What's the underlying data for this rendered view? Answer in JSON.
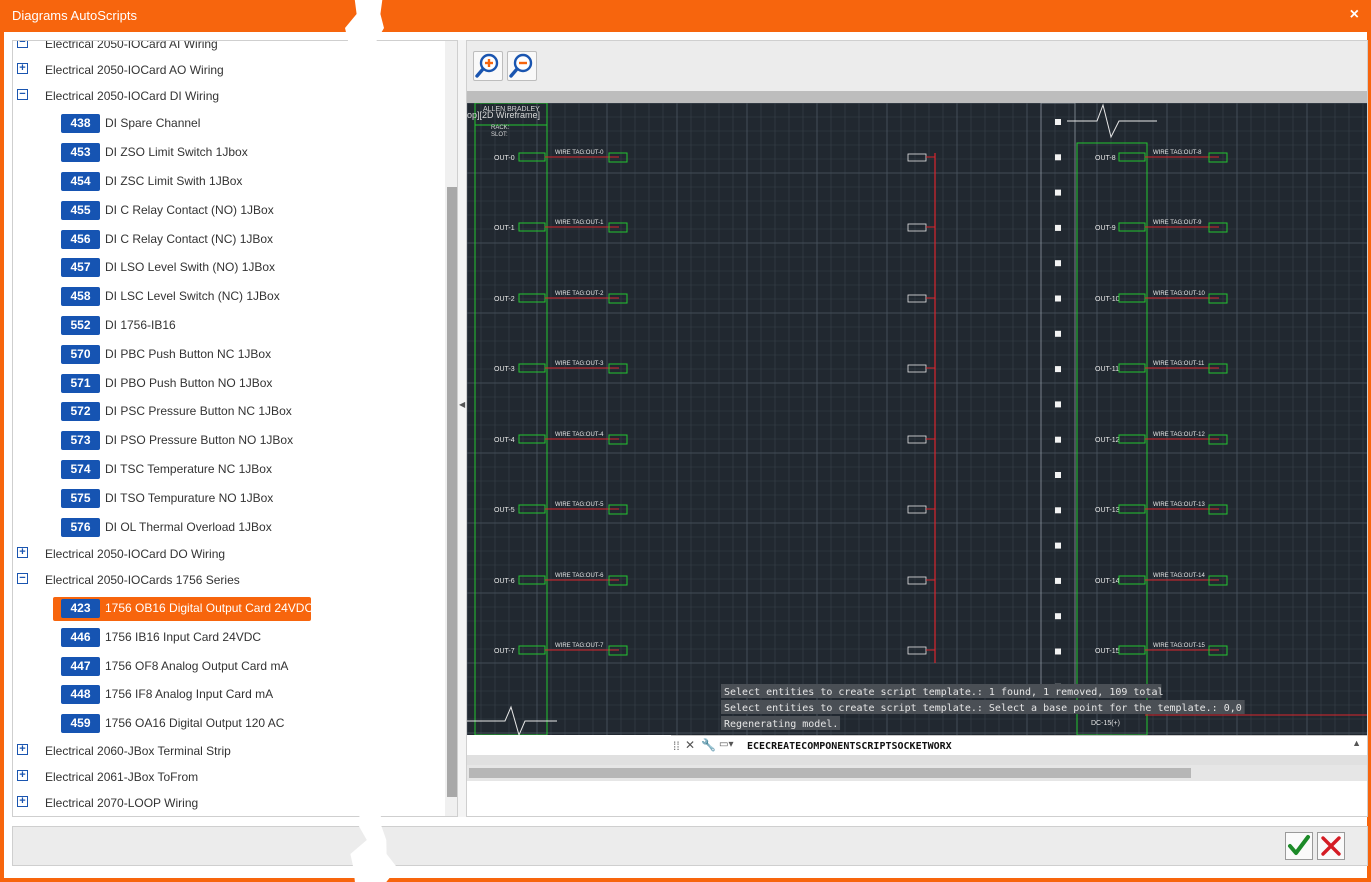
{
  "window": {
    "title": "Diagrams AutoScripts",
    "close_label": "×"
  },
  "tree": {
    "groups_top": [
      {
        "label": "Electrical 2050-IOCard AI Wiring",
        "expanded": true
      },
      {
        "label": "Electrical 2050-IOCard AO Wiring",
        "expanded": false
      },
      {
        "label": "Electrical 2050-IOCard DI Wiring",
        "expanded": true
      }
    ],
    "di_items": [
      {
        "id": "438",
        "label": "DI Spare Channel"
      },
      {
        "id": "453",
        "label": "DI ZSO Limit Switch 1Jbox"
      },
      {
        "id": "454",
        "label": "DI ZSC Limit Swith 1JBox"
      },
      {
        "id": "455",
        "label": "DI C Relay Contact (NO) 1JBox"
      },
      {
        "id": "456",
        "label": "DI C Relay Contact (NC) 1JBox"
      },
      {
        "id": "457",
        "label": "DI LSO Level Swith (NO) 1JBox"
      },
      {
        "id": "458",
        "label": "DI LSC Level Switch (NC) 1JBox"
      },
      {
        "id": "552",
        "label": "DI 1756-IB16"
      },
      {
        "id": "570",
        "label": "DI PBC Push Button NC 1JBox"
      },
      {
        "id": "571",
        "label": "DI PBO Push Button NO 1JBox"
      },
      {
        "id": "572",
        "label": "DI PSC Pressure Button NC 1JBox"
      },
      {
        "id": "573",
        "label": "DI PSO Pressure Button NO 1JBox"
      },
      {
        "id": "574",
        "label": "DI TSC Temperature NC 1JBox"
      },
      {
        "id": "575",
        "label": "DI TSO Tempurature NO 1JBox"
      },
      {
        "id": "576",
        "label": "DI OL Thermal Overload 1JBox"
      }
    ],
    "groups_mid": [
      {
        "label": "Electrical 2050-IOCard DO Wiring",
        "expanded": false
      },
      {
        "label": "Electrical 2050-IOCards 1756 Series",
        "expanded": true
      }
    ],
    "series_items": [
      {
        "id": "423",
        "label": "1756 OB16 Digital Output Card 24VDC",
        "selected": true
      },
      {
        "id": "446",
        "label": "1756 IB16 Input Card 24VDC"
      },
      {
        "id": "447",
        "label": "1756 OF8 Analog Output Card mA"
      },
      {
        "id": "448",
        "label": "1756 IF8 Analog Input Card mA"
      },
      {
        "id": "459",
        "label": "1756 OA16 Digital Output 120 AC"
      }
    ],
    "groups_bottom": [
      {
        "label": "Electrical 2060-JBox Terminal Strip",
        "expanded": false
      },
      {
        "label": "Electrical 2061-JBox ToFrom",
        "expanded": false
      },
      {
        "label": "Electrical 2070-LOOP Wiring",
        "expanded": false
      }
    ]
  },
  "drawing": {
    "header_label": "ALLEN BRADLEY",
    "viewport_label": "op][2D Wireframe]",
    "rack_label": "RACK:",
    "slot_label": "SLOT:",
    "left_outputs": [
      "OUT-0",
      "OUT-1",
      "OUT-2",
      "OUT-3",
      "OUT-4",
      "OUT-5",
      "OUT-6",
      "OUT-7"
    ],
    "right_outputs": [
      "OUT-8",
      "OUT-9",
      "OUT-10",
      "OUT-11",
      "OUT-12",
      "OUT-13",
      "OUT-14",
      "OUT-15"
    ],
    "left_wire_tags": [
      "WIRE TAG:OUT-0",
      "WIRE TAG:OUT-1",
      "WIRE TAG:OUT-2",
      "WIRE TAG:OUT-3",
      "WIRE TAG:OUT-4",
      "WIRE TAG:OUT-5",
      "WIRE TAG:OUT-6",
      "WIRE TAG:OUT-7"
    ],
    "right_wire_tags": [
      "WIRE TAG:OUT-8",
      "WIRE TAG:OUT-9",
      "WIRE TAG:OUT-10",
      "WIRE TAG:OUT-11",
      "WIRE TAG:OUT-12",
      "WIRE TAG:OUT-13",
      "WIRE TAG:OUT-14",
      "WIRE TAG:OUT-15"
    ],
    "dc_label": "DC-15(+)",
    "command_history": [
      "Select entities to create script template.: 1 found, 1 removed, 109 total",
      "Select entities to create script template.:  Select a base point for the template.: 0,0",
      "Regenerating model."
    ],
    "command_input": "ECECREATECOMPONENTSCRIPTSOCKETWORX"
  },
  "colors": {
    "accent": "#f7650d",
    "badge": "#1654b2",
    "canvas_bg": "#212830",
    "wire_green": "#23c630",
    "wire_red": "#d9262d"
  }
}
